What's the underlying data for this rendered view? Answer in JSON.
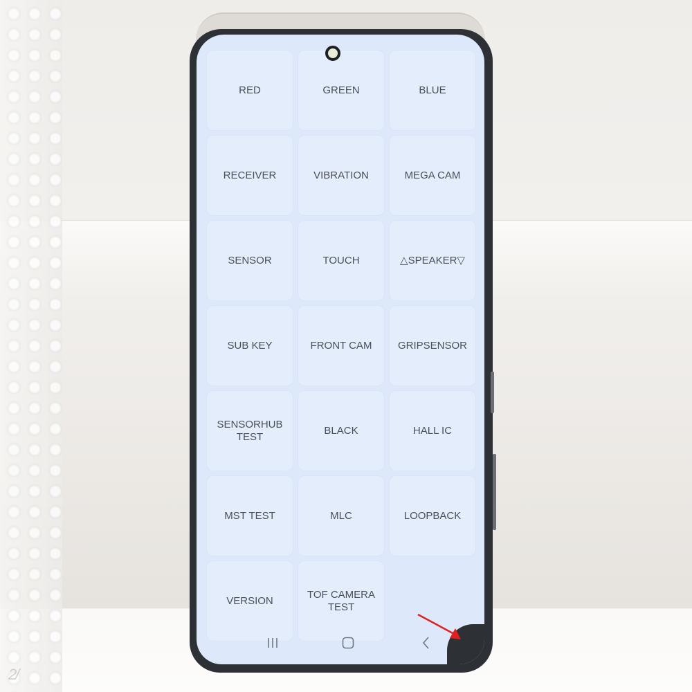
{
  "scene": {
    "description": "Photo of a phone display showing a hardware test menu",
    "watermark_text": "2/"
  },
  "test_menu": {
    "tiles": [
      {
        "label": "RED"
      },
      {
        "label": "GREEN"
      },
      {
        "label": "BLUE"
      },
      {
        "label": "RECEIVER"
      },
      {
        "label": "VIBRATION"
      },
      {
        "label": "MEGA CAM"
      },
      {
        "label": "SENSOR"
      },
      {
        "label": "TOUCH"
      },
      {
        "label": "△SPEAKER▽"
      },
      {
        "label": "SUB KEY"
      },
      {
        "label": "FRONT CAM"
      },
      {
        "label": "GRIPSENSOR"
      },
      {
        "label": "SENSORHUB\nTEST"
      },
      {
        "label": "BLACK"
      },
      {
        "label": "HALL IC"
      },
      {
        "label": "MST TEST"
      },
      {
        "label": "MLC"
      },
      {
        "label": "LOOPBACK"
      },
      {
        "label": "VERSION"
      },
      {
        "label": "TOF CAMERA\nTEST"
      }
    ]
  },
  "navbar": {
    "recent_icon": "recent-apps-icon",
    "home_icon": "home-icon",
    "back_icon": "back-icon"
  },
  "annotation": {
    "arrow_color": "#e02020",
    "arrow_target": "damaged display corner"
  },
  "colors": {
    "screen_bg": "#dde9fb",
    "tile_bg": "#e3edfc",
    "tile_text": "#4a4f57",
    "bezel": "#2d3136"
  }
}
